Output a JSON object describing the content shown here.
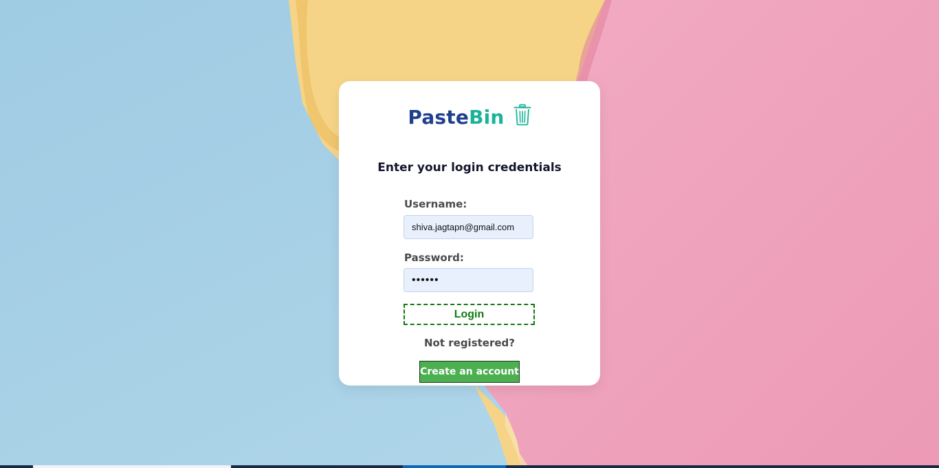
{
  "brand": {
    "name_part1": "Paste",
    "name_part2": "Bin",
    "icon": "trash-icon",
    "color_part1": "#1f3f8f",
    "color_part2": "#19b39a"
  },
  "form": {
    "heading": "Enter your login credentials",
    "username_label": "Username:",
    "username_value": "shiva.jagtapn@gmail.com",
    "password_label": "Password:",
    "password_value": "••••••",
    "login_label": "Login",
    "not_registered": "Not registered?",
    "create_account_label": "Create an account"
  },
  "colors": {
    "background_blue": "#a9d1e6",
    "background_yellow": "#f6d487",
    "background_pink": "#f0a8c0",
    "login_accent": "#0f7a0f",
    "create_button": "#4caf50"
  }
}
